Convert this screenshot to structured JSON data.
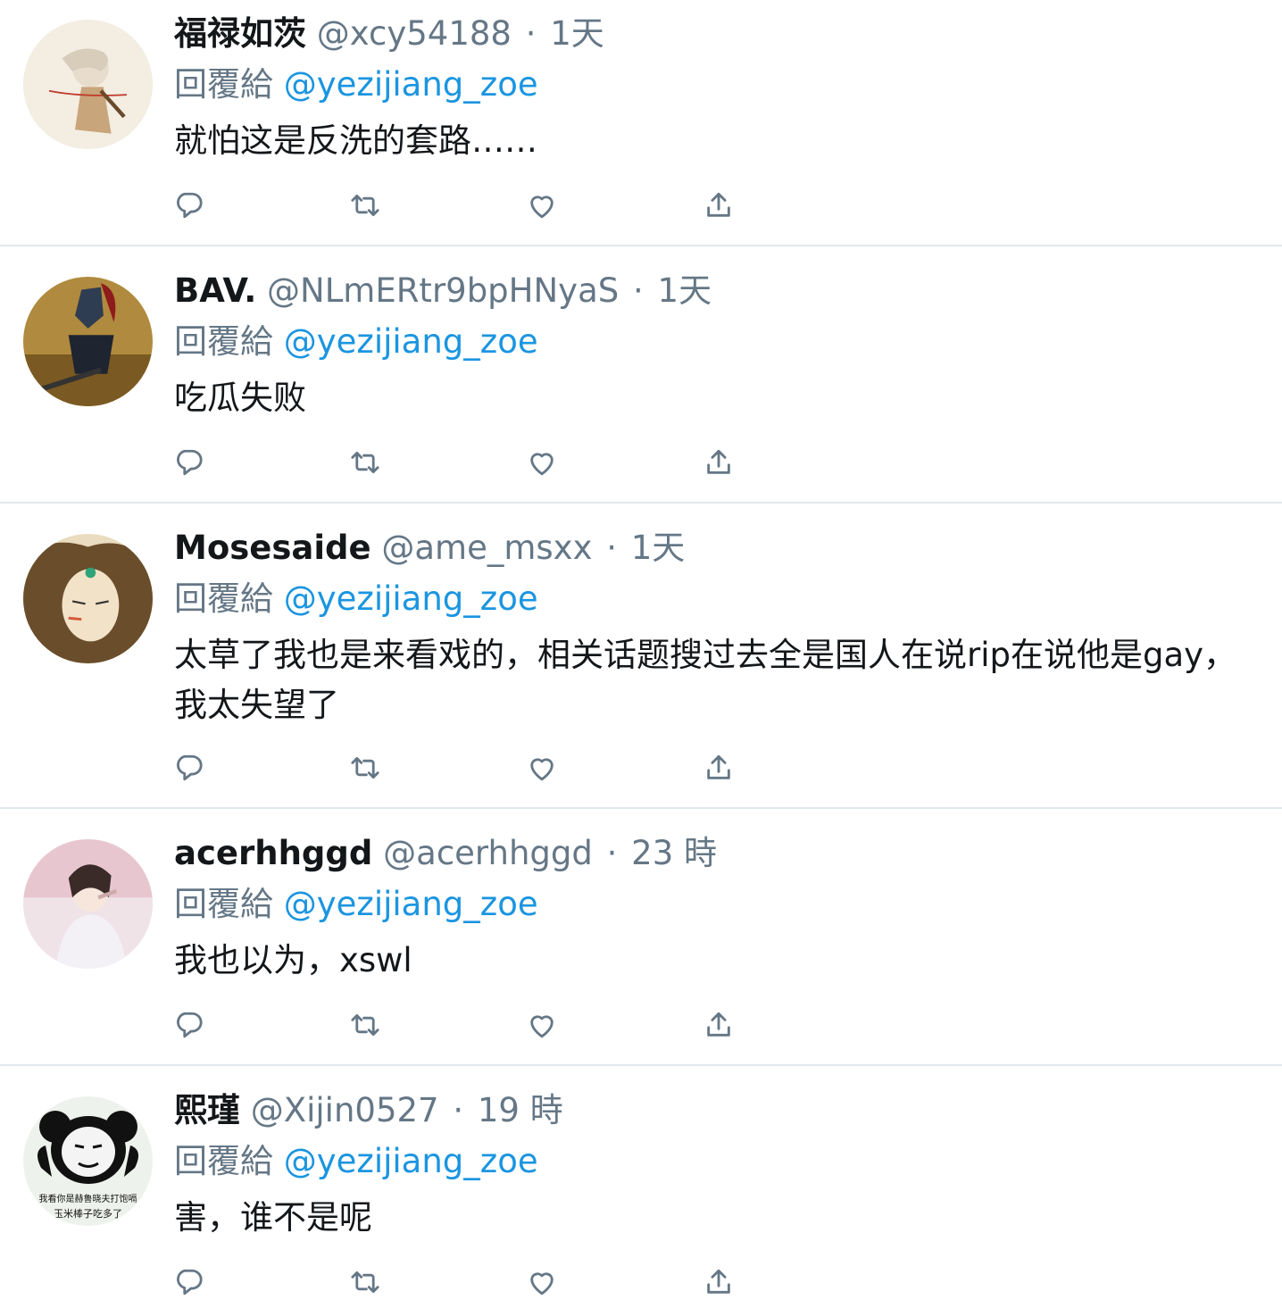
{
  "tweets": [
    {
      "name": "福禄如茨",
      "handle": "@xcy54188",
      "time": "1天",
      "reply_prefix": "回覆給",
      "reply_to": "@yezijiang_zoe",
      "text": "就怕这是反洗的套路……"
    },
    {
      "name": "BAV.",
      "handle": "@NLmERtr9bpHNyaS",
      "time": "1天",
      "reply_prefix": "回覆給",
      "reply_to": "@yezijiang_zoe",
      "text": "吃瓜失败"
    },
    {
      "name": "Mosesaide",
      "handle": "@ame_msxx",
      "time": "1天",
      "reply_prefix": "回覆給",
      "reply_to": "@yezijiang_zoe",
      "text": "太草了我也是来看戏的，相关话题搜过去全是国人在说rip在说他是gay，我太失望了"
    },
    {
      "name": "acerhhggd",
      "handle": "@acerhhggd",
      "time": "23 時",
      "reply_prefix": "回覆給",
      "reply_to": "@yezijiang_zoe",
      "text": "我也以为，xswl"
    },
    {
      "name": "熙瑾",
      "handle": "@Xijin0527",
      "time": "19 時",
      "reply_prefix": "回覆給",
      "reply_to": "@yezijiang_zoe",
      "text": "害，谁不是呢",
      "avatar_caption_1": "我看你是赫鲁晓夫打饱嗝",
      "avatar_caption_2": "玉米棒子吃多了"
    }
  ],
  "separator": "·",
  "icons": [
    "reply-icon",
    "retweet-icon",
    "like-icon",
    "share-icon"
  ],
  "colors": {
    "text": "#14171a",
    "secondary": "#657786",
    "link": "#1b95e0",
    "divider": "#e1e8ed"
  }
}
